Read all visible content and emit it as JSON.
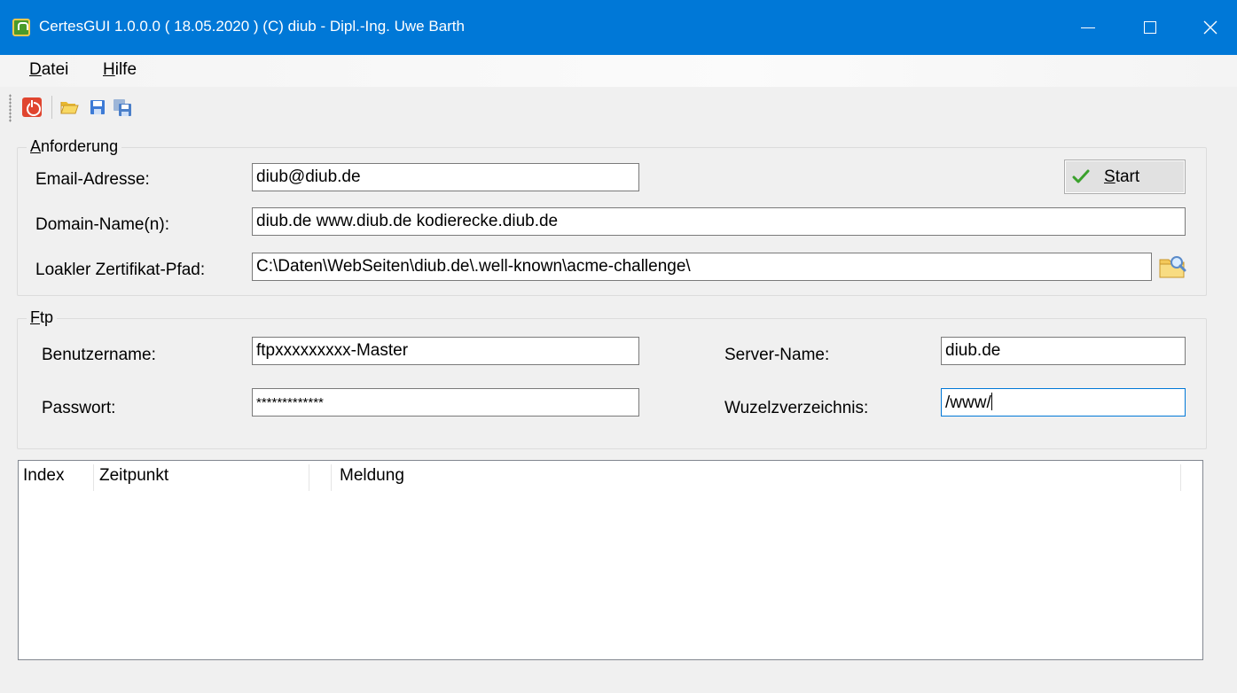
{
  "window": {
    "title": "CertesGUI 1.0.0.0  ( 18.05.2020 ) (C)  diub - Dipl.-Ing. Uwe Barth",
    "minimize_label": "—",
    "maximize_label": "☐",
    "close_label": "✕"
  },
  "menu": {
    "datei": {
      "acc": "D",
      "rest": "atei"
    },
    "hilfe": {
      "acc": "H",
      "rest": "ilfe"
    }
  },
  "toolbar": {
    "icons": [
      "power-icon",
      "open-folder-icon",
      "save-icon",
      "save-all-icon"
    ]
  },
  "anforderung": {
    "legend": {
      "acc": "A",
      "rest": "nforderung"
    },
    "email_label": "Email-Adresse:",
    "email_value": "diub@diub.de",
    "domain_label": "Domain-Name(n):",
    "domain_value": "diub.de www.diub.de kodierecke.diub.de",
    "path_label": "Loakler Zertifikat-Pfad:",
    "path_value": "C:\\Daten\\WebSeiten\\diub.de\\.well-known\\acme-challenge\\",
    "start_button": {
      "acc": "S",
      "rest": "tart"
    }
  },
  "ftp": {
    "legend": {
      "acc": "F",
      "rest": "tp"
    },
    "user_label": "Benutzername:",
    "user_value": "ftpxxxxxxxxx-Master",
    "password_label": "Passwort:",
    "password_value": "*************",
    "server_label": "Server-Name:",
    "server_value": "diub.de",
    "root_label": "Wuzelzverzeichnis:",
    "root_value": "/www/"
  },
  "log": {
    "columns": [
      "Index",
      "Zeitpunkt",
      "Meldung"
    ],
    "rows": []
  },
  "colors": {
    "titlebar": "#0078d7",
    "window_bg": "#f0f0f0",
    "focus_border": "#0078d7"
  }
}
